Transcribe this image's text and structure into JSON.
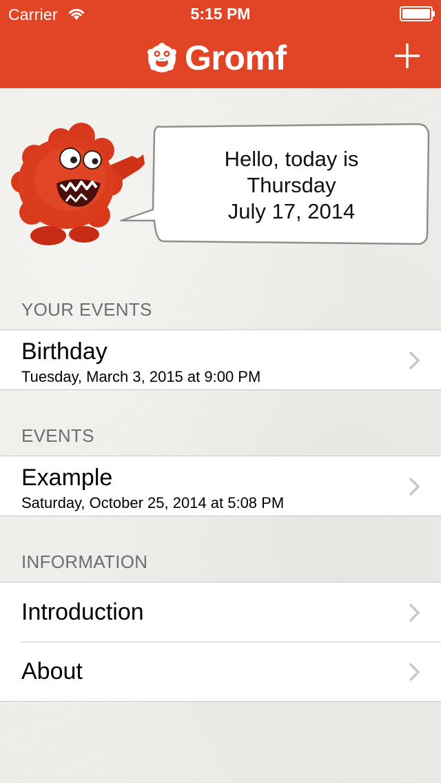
{
  "status_bar": {
    "carrier": "Carrier",
    "time": "5:15 PM"
  },
  "header": {
    "app_name": "Gromf",
    "logo_icon": "gromf-monster-logo-icon",
    "add_icon": "plus-icon",
    "background_color": "#e24526"
  },
  "greeting": {
    "line1": "Hello, today is",
    "line2": "Thursday",
    "line3": "July 17, 2014"
  },
  "sections": {
    "your_events": {
      "header": "YOUR EVENTS",
      "items": [
        {
          "title": "Birthday",
          "subtitle": "Tuesday, March 3, 2015 at 9:00 PM"
        }
      ]
    },
    "events": {
      "header": "EVENTS",
      "items": [
        {
          "title": "Example",
          "subtitle": "Saturday, October 25, 2014 at 5:08 PM"
        }
      ]
    },
    "information": {
      "header": "INFORMATION",
      "items": [
        {
          "title": "Introduction"
        },
        {
          "title": "About"
        }
      ]
    }
  },
  "colors": {
    "accent": "#e24526",
    "separator": "#c8c7cc",
    "section_header_text": "#6d6d72",
    "chevron": "#c7c7cc"
  }
}
